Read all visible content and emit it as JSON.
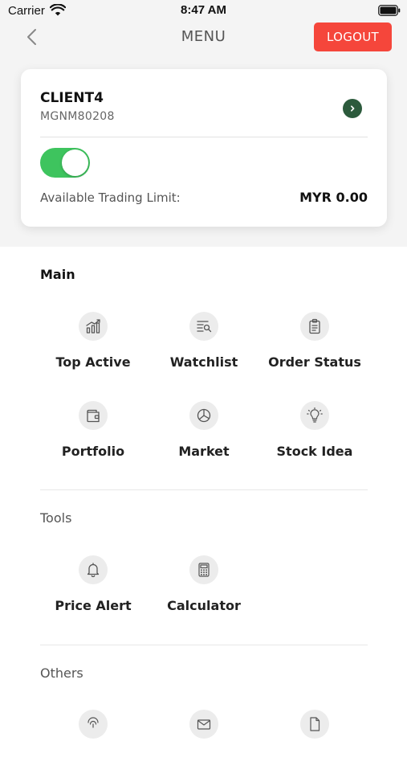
{
  "status_bar": {
    "carrier": "Carrier",
    "time": "8:47 AM"
  },
  "nav": {
    "title": "MENU",
    "logout_label": "LOGOUT"
  },
  "account": {
    "client_name": "CLIENT4",
    "client_id": "MGNM80208",
    "toggle_on": true,
    "limit_label": "Available Trading Limit:",
    "limit_value": "MYR 0.00"
  },
  "sections": {
    "main": {
      "title": "Main",
      "items": [
        {
          "label": "Top Active",
          "icon": "bar-chart-icon"
        },
        {
          "label": "Watchlist",
          "icon": "list-search-icon"
        },
        {
          "label": "Order Status",
          "icon": "clipboard-icon"
        },
        {
          "label": "Portfolio",
          "icon": "wallet-icon"
        },
        {
          "label": "Market",
          "icon": "pie-chart-icon"
        },
        {
          "label": "Stock Idea",
          "icon": "lightbulb-icon"
        }
      ]
    },
    "tools": {
      "title": "Tools",
      "items": [
        {
          "label": "Price Alert",
          "icon": "bell-icon"
        },
        {
          "label": "Calculator",
          "icon": "calculator-icon"
        }
      ]
    },
    "others": {
      "title": "Others",
      "items": [
        {
          "icon": "fingerprint-icon"
        },
        {
          "icon": "mail-icon"
        },
        {
          "icon": "document-icon"
        }
      ]
    }
  },
  "colors": {
    "logout_bg": "#f5463b",
    "toggle_on": "#3ec45e",
    "arrow_bg": "#2c5a3c",
    "top_background": "#f4f4f4"
  }
}
